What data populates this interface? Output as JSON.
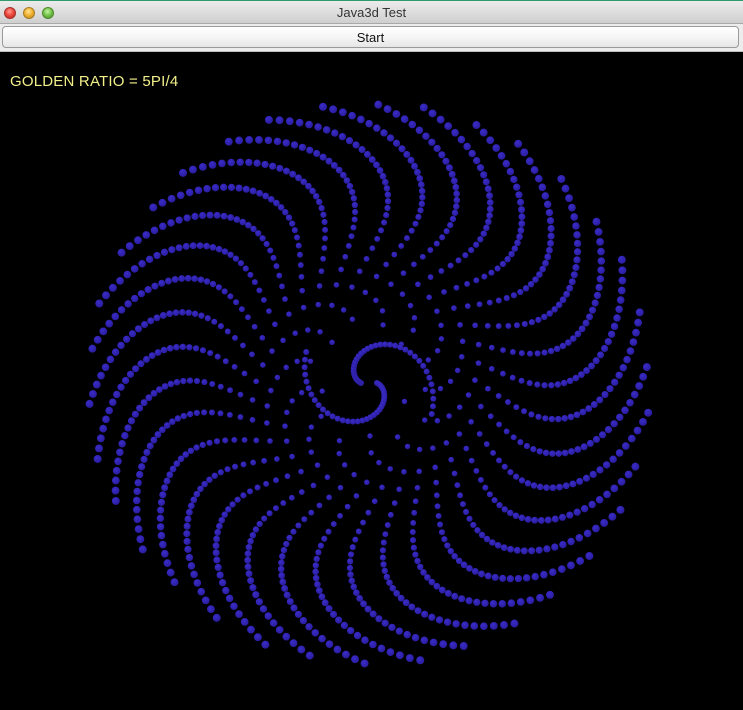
{
  "window": {
    "title": "Java3d Test"
  },
  "toolbar": {
    "start_label": "Start"
  },
  "canvas": {
    "label": "GOLDEN RATIO = 5PI/4",
    "background": "#000000",
    "label_color": "#f2f08a",
    "dot_color": "#2a1d9e",
    "dot_highlight": "#3a2cc8"
  }
}
